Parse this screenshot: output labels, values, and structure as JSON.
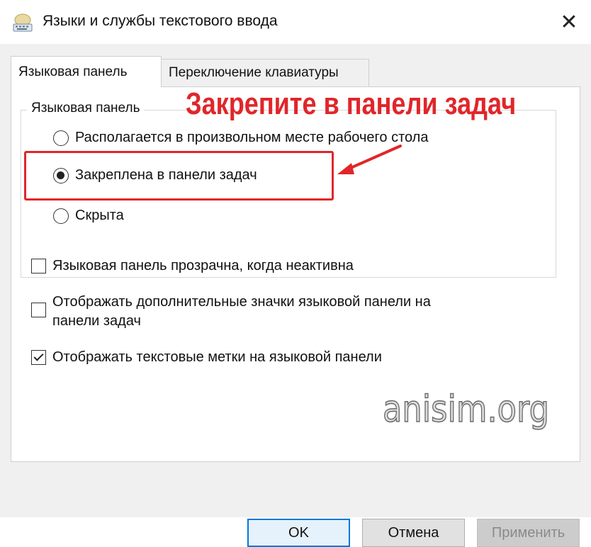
{
  "window": {
    "title": "Языки и службы текстового ввода",
    "close_glyph": "✕",
    "icon": "keyboard-icon"
  },
  "tabs": [
    {
      "label": "Языковая панель",
      "active": true
    },
    {
      "label": "Переключение клавиатуры",
      "active": false
    }
  ],
  "group": {
    "legend": "Языковая панель",
    "options": [
      {
        "label": "Располагается в произвольном месте рабочего стола",
        "checked": false
      },
      {
        "label": "Закреплена в панели задач",
        "checked": true
      },
      {
        "label": "Скрыта",
        "checked": false
      }
    ]
  },
  "checkboxes": [
    {
      "label": "Языковая панель прозрачна, когда неактивна",
      "checked": false
    },
    {
      "label_line1": "Отображать дополнительные значки языковой панели на",
      "label_line2": "панели задач",
      "checked": false
    },
    {
      "label": "Отображать текстовые метки на языковой панели",
      "checked": true
    }
  ],
  "annotation": {
    "text": "Закрепите в панели задач",
    "color": "#e0262a"
  },
  "watermark": "anisim.org",
  "buttons": {
    "ok": "OK",
    "cancel": "Отмена",
    "apply": "Применить"
  },
  "colors": {
    "accent": "#0078d7",
    "annotation_red": "#e0262a"
  }
}
